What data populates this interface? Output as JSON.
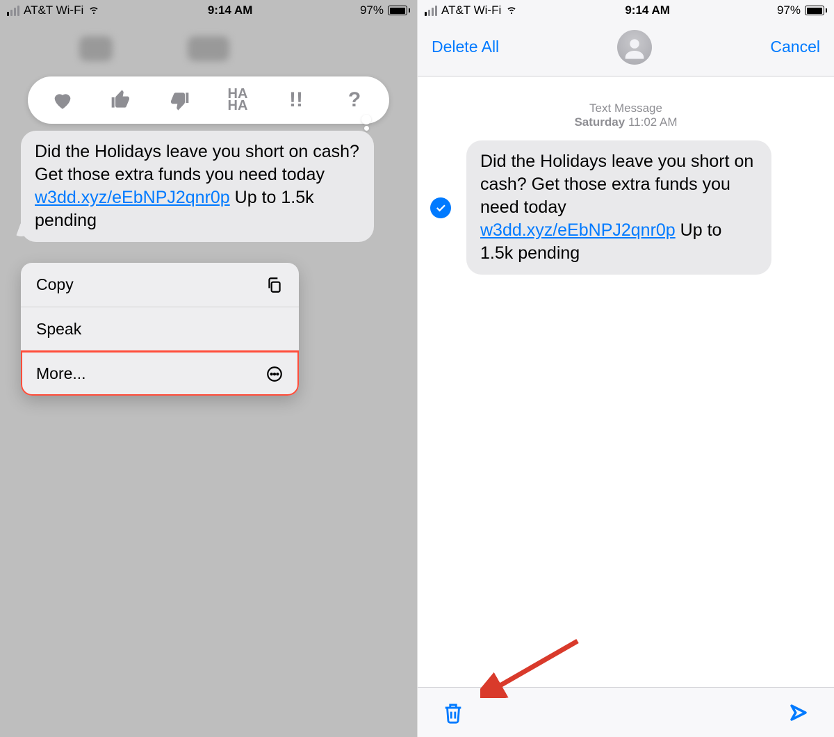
{
  "status": {
    "carrier": "AT&T Wi-Fi",
    "time": "9:14 AM",
    "battery_pct": "97%",
    "battery_fill": 97
  },
  "tapback": {
    "reactions": [
      "heart",
      "thumbs-up",
      "thumbs-down",
      "haha",
      "exclaim",
      "question"
    ]
  },
  "message": {
    "text_part1": " Did the Holidays leave you short on cash? Get those extra funds you need today ",
    "link": "w3dd.xyz/eEbNPJ2qnr0p",
    "text_part2": " Up to 1.5k pending"
  },
  "menu": {
    "copy": "Copy",
    "speak": "Speak",
    "more": "More..."
  },
  "right_header": {
    "delete_all": "Delete All",
    "cancel": "Cancel"
  },
  "meta": {
    "label": "Text Message",
    "day": "Saturday",
    "time": "11:02 AM"
  },
  "colors": {
    "ios_blue": "#007aff",
    "bubble_gray": "#e9e9eb",
    "highlight_red": "#ff4d3a"
  }
}
